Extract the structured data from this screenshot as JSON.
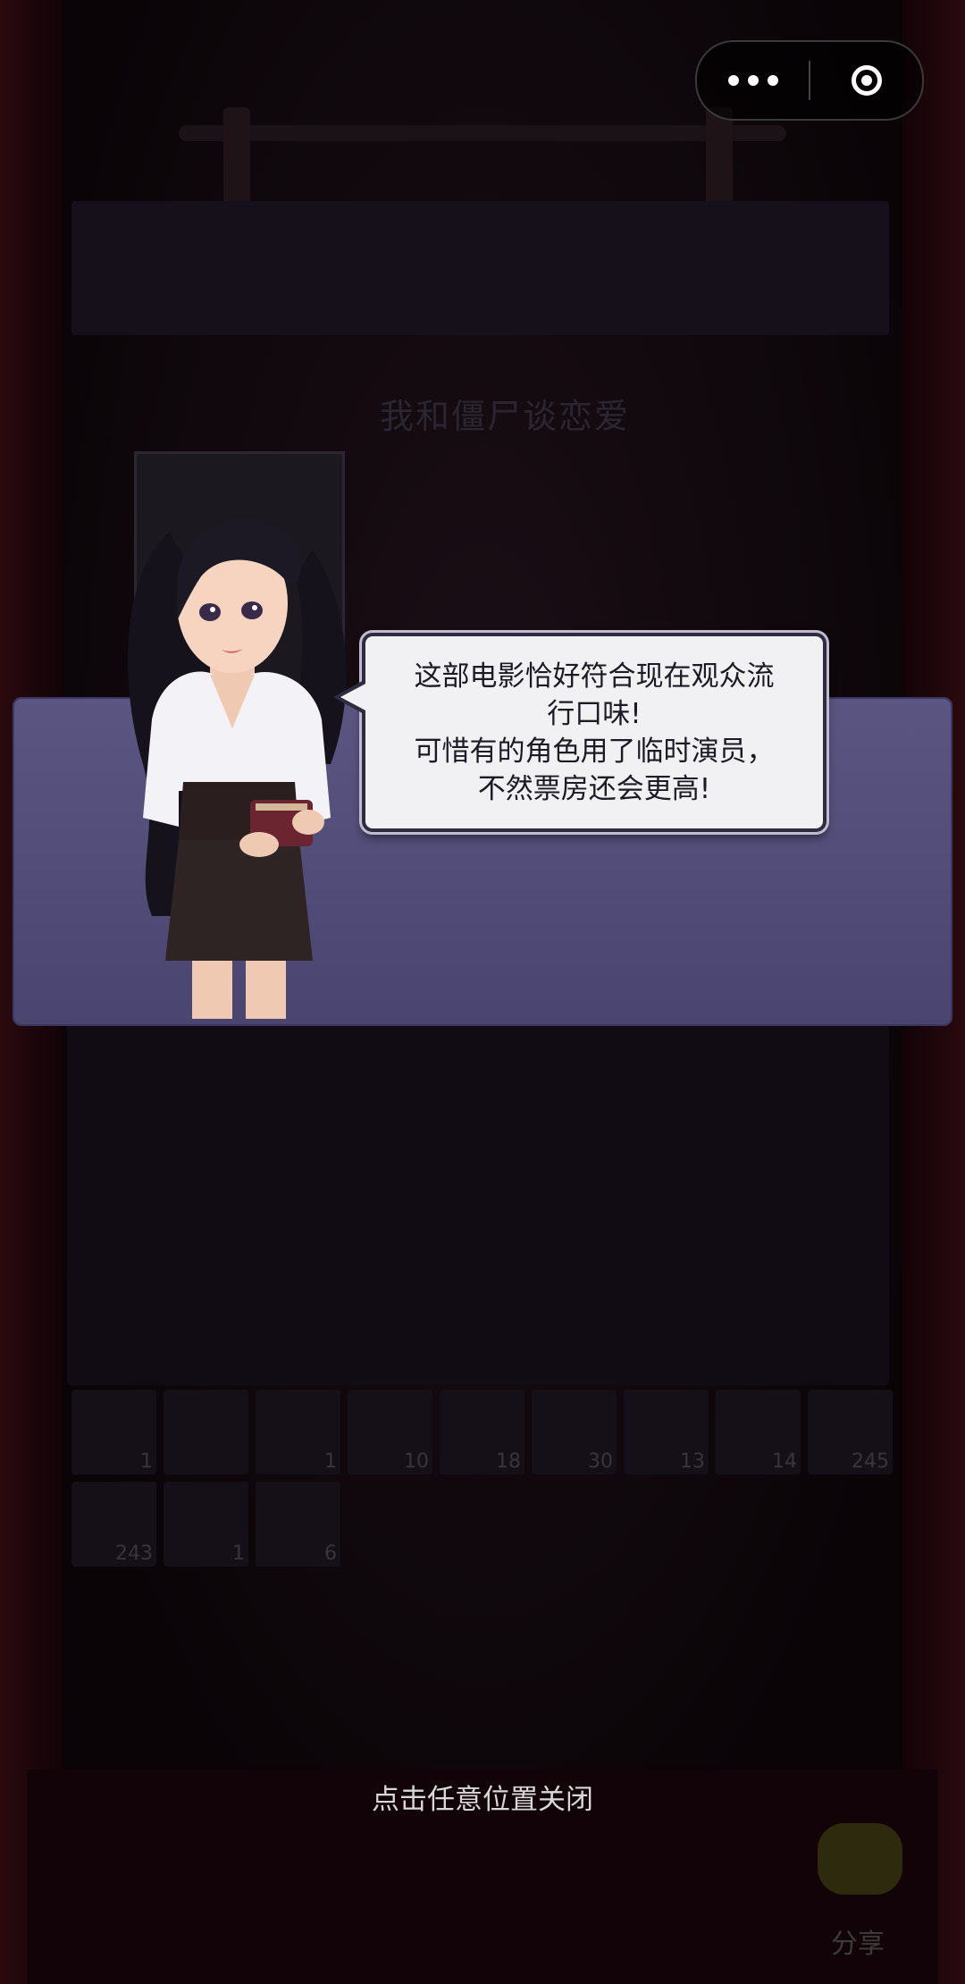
{
  "capsule": {
    "more_icon": "more-dots-icon",
    "close_icon": "target-close-icon"
  },
  "background": {
    "movie_title": "我和僵尸谈恋爱",
    "rewards": [
      {
        "icon": "item-1",
        "count": "1"
      },
      {
        "icon": "item-2",
        "count": ""
      },
      {
        "icon": "item-3",
        "count": "1"
      },
      {
        "icon": "item-4",
        "count": "10"
      },
      {
        "icon": "item-5",
        "count": "18"
      },
      {
        "icon": "item-6",
        "count": "30"
      },
      {
        "icon": "item-7",
        "count": "13"
      },
      {
        "icon": "item-8",
        "count": "14"
      },
      {
        "icon": "item-9",
        "count": "245"
      },
      {
        "icon": "item-10",
        "count": "243"
      },
      {
        "icon": "item-11",
        "count": "1"
      },
      {
        "icon": "item-12",
        "count": "6"
      }
    ],
    "share_label": "分享"
  },
  "dialog": {
    "speech_lines": [
      "这部电影恰好符合现在观众流",
      "行口味!",
      "可惜有的角色用了临时演员，",
      "不然票房还会更高!"
    ]
  },
  "close_hint": "点击任意位置关闭",
  "colors": {
    "band": "#5b5582",
    "bubble": "#f1f0f3",
    "bubble_border": "#2f2c42"
  }
}
